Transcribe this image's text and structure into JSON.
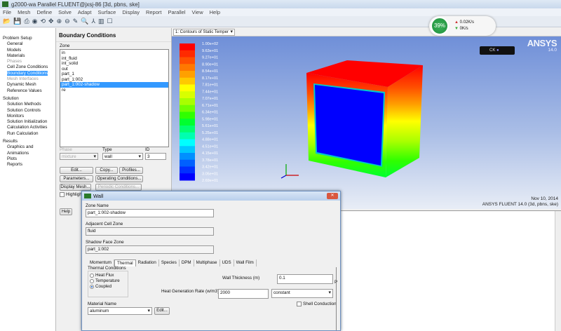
{
  "window": {
    "title": "g2000-wa Parallel FLUENT@jxsj-86  [3d, pbns, ske]"
  },
  "menu": [
    "File",
    "Mesh",
    "Define",
    "Solve",
    "Adapt",
    "Surface",
    "Display",
    "Report",
    "Parallel",
    "View",
    "Help"
  ],
  "toolbar_icons": [
    "open-icon",
    "save-icon",
    "print-icon",
    "help-icon",
    "rotate-icon",
    "pan-icon",
    "zoom-in-icon",
    "zoom-out-icon",
    "probe-icon",
    "zoom-box-icon",
    "axes-icon",
    "layout-icon",
    "window-icon"
  ],
  "tree": {
    "sections": [
      {
        "label": "Problem Setup",
        "items": [
          {
            "label": "General"
          },
          {
            "label": "Models"
          },
          {
            "label": "Materials"
          },
          {
            "label": "Phases",
            "disabled": true
          },
          {
            "label": "Cell Zone Conditions"
          },
          {
            "label": "Boundary Conditions",
            "selected": true
          },
          {
            "label": "Mesh Interfaces",
            "disabled": true
          },
          {
            "label": "Dynamic Mesh"
          },
          {
            "label": "Reference Values"
          }
        ]
      },
      {
        "label": "Solution",
        "items": [
          {
            "label": "Solution Methods"
          },
          {
            "label": "Solution Controls"
          },
          {
            "label": "Monitors"
          },
          {
            "label": "Solution Initialization"
          },
          {
            "label": "Calculation Activities"
          },
          {
            "label": "Run Calculation"
          }
        ]
      },
      {
        "label": "Results",
        "items": [
          {
            "label": "Graphics and Animations"
          },
          {
            "label": "Plots"
          },
          {
            "label": "Reports"
          }
        ]
      }
    ]
  },
  "bc": {
    "title": "Boundary Conditions",
    "zone_label": "Zone",
    "zones": [
      "in",
      "int_fluid",
      "int_solid",
      "out",
      "part_1",
      "part_1:002",
      "part_1:002-shadow",
      "re"
    ],
    "selected_zone": "part_1:002-shadow",
    "phase_label": "Phase",
    "phase_value": "mixture",
    "type_label": "Type",
    "type_value": "wall",
    "id_label": "ID",
    "id_value": "3",
    "edit": "Edit...",
    "copy": "Copy...",
    "profiles": "Profiles...",
    "parameters": "Parameters...",
    "operating": "Operating Conditions...",
    "display_mesh": "Display Mesh...",
    "periodic": "Periodic Conditions...",
    "highlight": "Highlight Zone",
    "help": "Help"
  },
  "graphics": {
    "window_select": "1: Contours of Static Temper",
    "brand": "ANSYS",
    "version": "14.0",
    "ctrl_label": "CK",
    "date": "Nov 10, 2014",
    "info": "ANSYS FLUENT 14.0 (3d, pbns, ske)",
    "colorbar_labels": [
      "1.00e+02",
      "9.63e+01",
      "9.27e+01",
      "8.90e+01",
      "8.54e+01",
      "8.17e+01",
      "7.81e+01",
      "7.44e+01",
      "7.07e+01",
      "6.71e+01",
      "6.34e+01",
      "5.98e+01",
      "5.61e+01",
      "5.25e+01",
      "4.88e+01",
      "4.51e+01",
      "4.15e+01",
      "3.78e+01",
      "3.42e+01",
      "3.05e+01",
      "2.69e+01"
    ],
    "colorbar_colors": [
      "#ff0000",
      "#ff2a00",
      "#ff5000",
      "#ff7800",
      "#ffa000",
      "#ffc800",
      "#ffff00",
      "#d8ff00",
      "#a8ff00",
      "#70ff00",
      "#30ff00",
      "#00ff30",
      "#00ff70",
      "#00ffb0",
      "#00ffff",
      "#00c8ff",
      "#0090ff",
      "#0060ff",
      "#0030ff",
      "#0000ff"
    ]
  },
  "progress": {
    "percent": "39%",
    "upload": "0.02K/s",
    "download": "0K/s"
  },
  "dialog": {
    "title": "Wall",
    "zone_name_label": "Zone Name",
    "zone_name": "part_1:002-shadow",
    "adjacent_label": "Adjacent Cell Zone",
    "adjacent": "fluid",
    "shadow_label": "Shadow Face Zone",
    "shadow": "part_1:002",
    "tabs": [
      "Momentum",
      "Thermal",
      "Radiation",
      "Species",
      "DPM",
      "Multiphase",
      "UDS",
      "Wall Film"
    ],
    "active_tab": "Thermal",
    "thermal_conditions_label": "Thermal Conditions",
    "radios": [
      {
        "label": "Heat Flux",
        "checked": false
      },
      {
        "label": "Temperature",
        "checked": false
      },
      {
        "label": "Coupled",
        "checked": true
      }
    ],
    "wall_thickness_label": "Wall Thickness (m)",
    "wall_thickness": "0.1",
    "p_label": "P",
    "heat_gen_label": "Heat Generation Rate (w/m3)",
    "heat_gen": "2000",
    "heat_gen_method": "constant",
    "shell_conduction": "Shell Conduction",
    "material_label": "Material Name",
    "material": "aluminum",
    "material_edit": "Edit..."
  }
}
